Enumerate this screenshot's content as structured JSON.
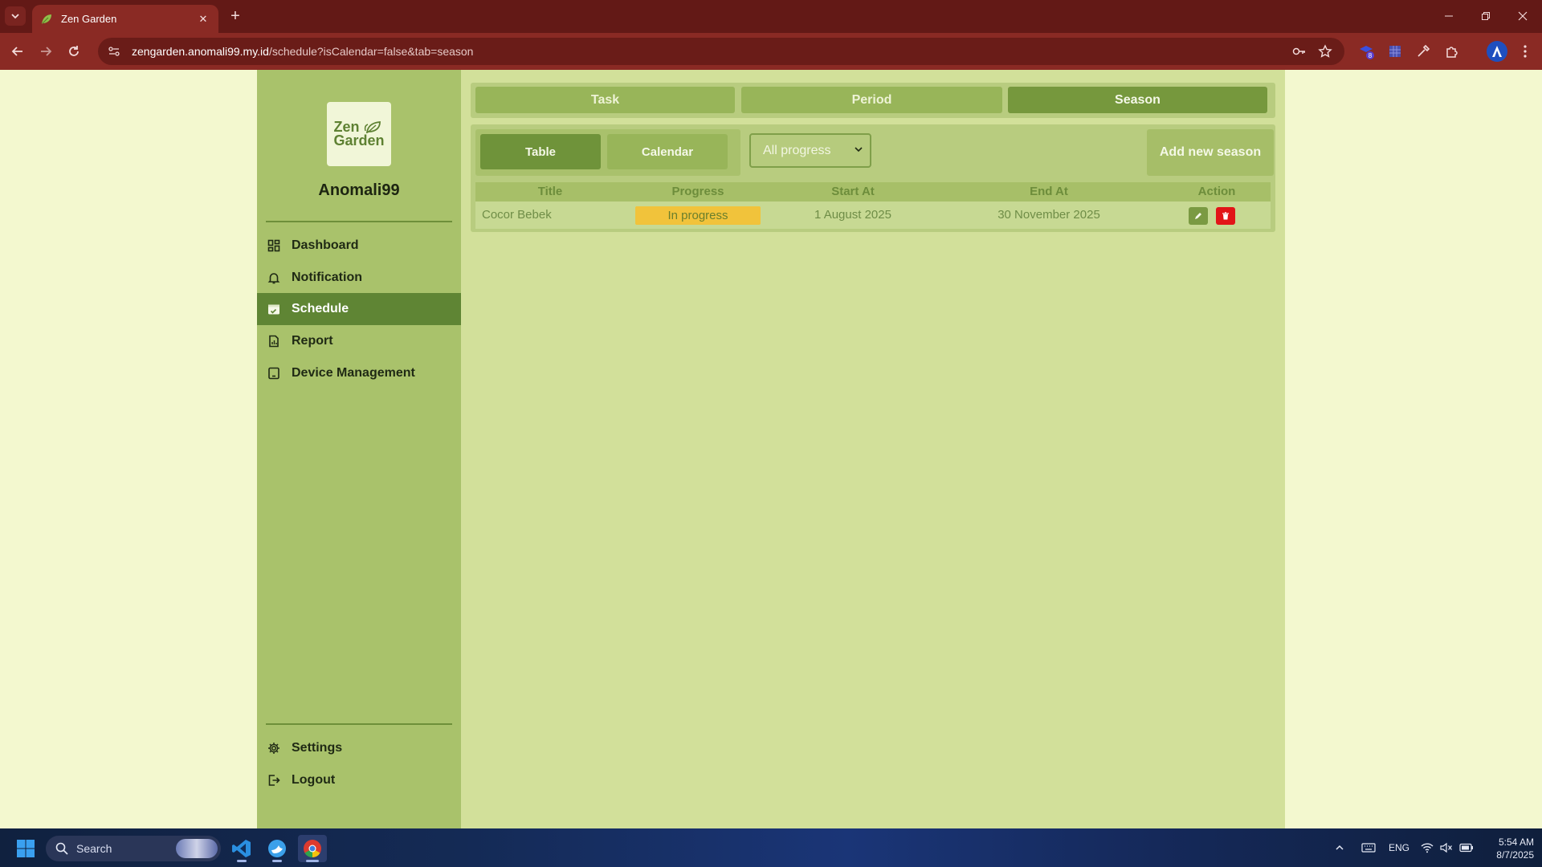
{
  "browser": {
    "tab_title": "Zen Garden",
    "url_host": "zengarden.anomali99.my.id",
    "url_path": "/schedule?isCalendar=false&tab=season",
    "profile_initial": "A",
    "extension_badge": "8",
    "accent_color": "#8a2a24"
  },
  "sidebar": {
    "logo_line1": "Zen",
    "logo_line2": "Garden",
    "username": "Anomali99",
    "items": [
      {
        "label": "Dashboard",
        "icon": "dashboard-icon"
      },
      {
        "label": "Notification",
        "icon": "bell-icon"
      },
      {
        "label": "Schedule",
        "icon": "calendar-icon",
        "active": true
      },
      {
        "label": "Report",
        "icon": "report-icon"
      },
      {
        "label": "Device Management",
        "icon": "tablet-icon"
      }
    ],
    "bottom_items": [
      {
        "label": "Settings",
        "icon": "gear-icon"
      },
      {
        "label": "Logout",
        "icon": "logout-icon"
      }
    ]
  },
  "tabs": [
    {
      "label": "Task"
    },
    {
      "label": "Period"
    },
    {
      "label": "Season",
      "active": true
    }
  ],
  "view_toggle": {
    "table_label": "Table",
    "calendar_label": "Calendar",
    "active": "Table"
  },
  "filter": {
    "selected": "All progress"
  },
  "add_button": "Add new season",
  "table": {
    "headers": [
      "Title",
      "Progress",
      "Start At",
      "End At",
      "Action"
    ],
    "rows": [
      {
        "title": "Cocor Bebek",
        "progress": "In progress",
        "start_at": "1 August 2025",
        "end_at": "30 November 2025"
      }
    ]
  },
  "taskbar": {
    "search_placeholder": "Search",
    "language": "ENG",
    "time": "5:54 AM",
    "date": "8/7/2025"
  }
}
